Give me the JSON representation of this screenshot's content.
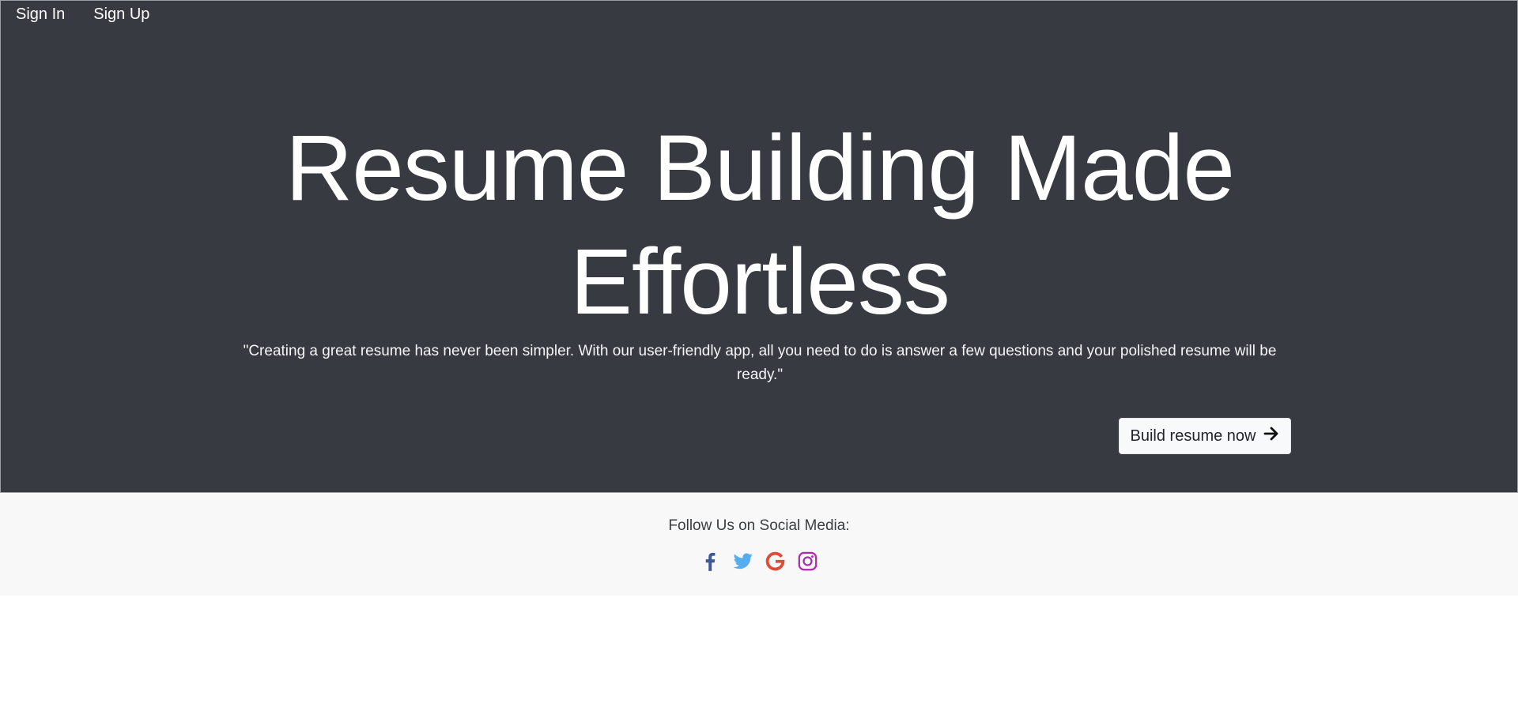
{
  "nav": {
    "sign_in": "Sign In",
    "sign_up": "Sign Up"
  },
  "hero": {
    "headline_line1": "Resume Building Made",
    "headline_line2": "Effortless",
    "tagline": "\"Creating a great resume has never been simpler. With our user-friendly app, all you need to do is answer a few questions and your polished resume will be ready.\"",
    "cta_label": "Build resume now",
    "cta_icon": "arrow-right-icon"
  },
  "footer": {
    "follow_text": "Follow Us on Social Media:",
    "social": [
      {
        "icon": "facebook-icon",
        "color": "#3b5998"
      },
      {
        "icon": "twitter-icon",
        "color": "#55acee"
      },
      {
        "icon": "google-icon",
        "color": "#dd4b39"
      },
      {
        "icon": "instagram-icon",
        "color": "#ac2bac"
      }
    ]
  },
  "colors": {
    "hero_background": "#373a40",
    "footer_background": "#f8f8f8",
    "button_background": "#f8f9fa"
  }
}
